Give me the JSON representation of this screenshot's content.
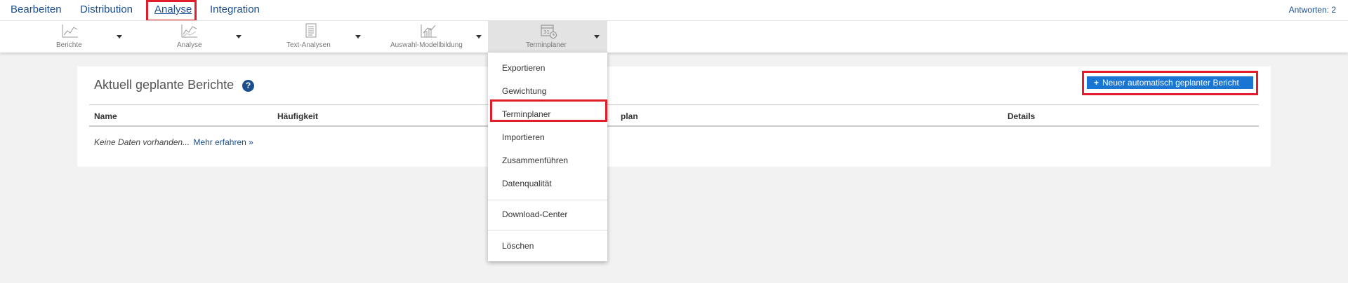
{
  "topnav": {
    "items": [
      {
        "label": "Bearbeiten"
      },
      {
        "label": "Distribution"
      },
      {
        "label": "Analyse",
        "active": true
      },
      {
        "label": "Integration"
      }
    ],
    "answers": "Antworten: 2"
  },
  "toolbar": {
    "items": [
      {
        "label": "Berichte",
        "icon": "line-chart-icon"
      },
      {
        "label": "Analyse",
        "icon": "analysis-chart-icon"
      },
      {
        "label": "Text-Analysen",
        "icon": "text-document-icon"
      },
      {
        "label": "Auswahl-Modellbildung",
        "icon": "bar-model-icon"
      },
      {
        "label": "Terminplaner",
        "icon": "calendar-clock-icon",
        "active": true
      }
    ]
  },
  "panel": {
    "title": "Aktuell geplante Berichte",
    "help_icon": "?",
    "new_button": "Neuer automatisch geplanter Bericht",
    "columns": [
      "Name",
      "Häufigkeit",
      "plan",
      "Details"
    ],
    "empty_text": "Keine Daten vorhanden...",
    "more_link": "Mehr erfahren »"
  },
  "dropdown": {
    "items": [
      "Exportieren",
      "Gewichtung",
      "Terminplaner",
      "Importieren",
      "Zusammenführen",
      "Datenqualität",
      "Download-Center",
      "Löschen"
    ]
  },
  "colors": {
    "brand_blue": "#1b4e8e",
    "button_blue": "#1b76d3",
    "highlight_red": "#e11d2b"
  }
}
